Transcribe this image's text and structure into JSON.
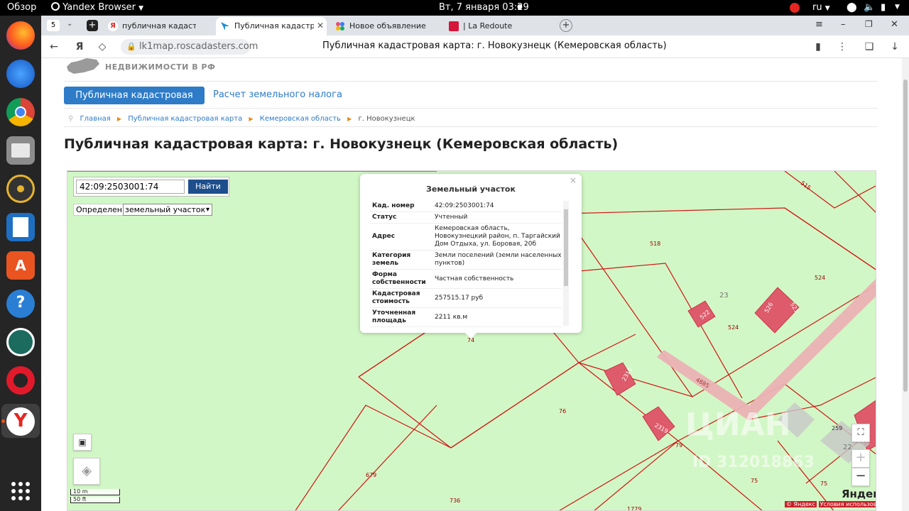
{
  "topbar": {
    "overview": "Обзор",
    "app_name": "Yandex Browser",
    "clock": "Вт, 7 января  03:29",
    "lang": "ru"
  },
  "tabs": {
    "count": "5",
    "items": [
      {
        "label": "публичная кадастровая к"
      },
      {
        "label": "Публичная кадастрова"
      },
      {
        "label": "Новое объявление — Объ"
      },
      {
        "label": "| La Redoute"
      }
    ]
  },
  "address": {
    "url": "lk1map.roscadasters.com",
    "title": "Публичная кадастровая карта: г. Новокузнецк (Кемеровская область)"
  },
  "site": {
    "logo_line": "НЕДВИЖИМОСТИ В РФ",
    "nav_active": "Публичная кадастровая карта",
    "nav_tax": "Расчет земельного налога",
    "breadcrumbs": [
      "Главная",
      "Публичная кадастровая карта",
      "Кемеровская область",
      "г. Новокузнецк"
    ],
    "heading": "Публичная кадастровая карта: г. Новокузнецк (Кемеровская область)"
  },
  "map": {
    "search_value": "42:09:2503001:74",
    "search_button": "Найти",
    "definition_label": "Определение:",
    "definition_value": "земельный участок",
    "scale_m": "10 m",
    "scale_ft": "50 ft",
    "yandex": "Яндекс",
    "copyright_1": "© Яндекс",
    "copyright_2": "Условия использования",
    "zoom_in": "+",
    "zoom_out": "−",
    "watermark": "ЦИАН",
    "watermark_id": "ID 312018863",
    "parcel_labels": [
      "515",
      "518",
      "524",
      "23",
      "524",
      "74",
      "76",
      "79",
      "75",
      "75",
      "679",
      "736",
      "1779",
      "259",
      "22",
      "2311",
      "2319",
      "4885",
      "522",
      "526",
      "521"
    ]
  },
  "popup": {
    "title": "Земельный участок",
    "close": "×",
    "rows": [
      {
        "key": "Кад. номер",
        "value": "42:09:2503001:74"
      },
      {
        "key": "Статус",
        "value": "Учтенный"
      },
      {
        "key": "Адрес",
        "value": "Кемеровская область, Новокузнецкий район, п. Таргайский Дом Отдыха, ул. Боровая, 20б"
      },
      {
        "key": "Категория земель",
        "value": "Земли поселений (земли населенных пунктов)"
      },
      {
        "key": "Форма собственности",
        "value": "Частная собственность"
      },
      {
        "key": "Кадастровая стоимость",
        "value": "257515.17 руб"
      },
      {
        "key": "Уточненная площадь",
        "value": "2211 кв.м"
      }
    ]
  }
}
